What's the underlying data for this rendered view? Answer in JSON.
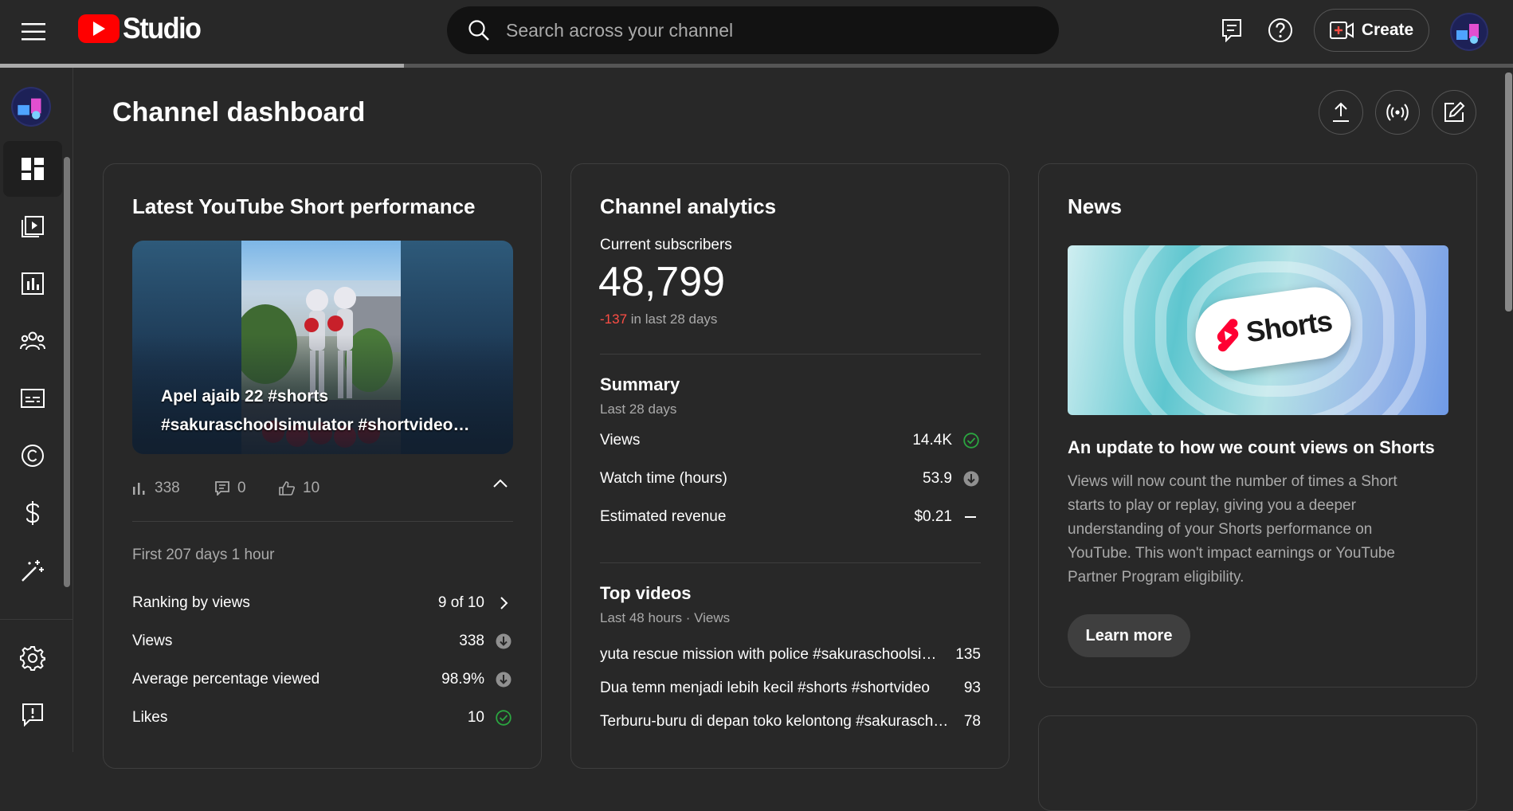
{
  "header": {
    "brand": "Studio",
    "search_placeholder": "Search across your channel",
    "create_label": "Create",
    "upload_progress": 0.267
  },
  "sidebar": {
    "items": [
      {
        "name": "dashboard",
        "icon": "dashboard-icon",
        "active": true
      },
      {
        "name": "content",
        "icon": "content-icon"
      },
      {
        "name": "analytics",
        "icon": "analytics-icon"
      },
      {
        "name": "community",
        "icon": "community-icon"
      },
      {
        "name": "subtitles",
        "icon": "subtitles-icon"
      },
      {
        "name": "copyright",
        "icon": "copyright-icon"
      },
      {
        "name": "earn",
        "icon": "dollar-icon"
      },
      {
        "name": "customization",
        "icon": "magic-wand-icon"
      }
    ],
    "bottom": [
      {
        "name": "settings",
        "icon": "gear-icon"
      },
      {
        "name": "feedback",
        "icon": "feedback-icon"
      }
    ]
  },
  "page": {
    "title": "Channel dashboard"
  },
  "short_card": {
    "title": "Latest YouTube Short performance",
    "video_title_line1": "Apel ajaib 22 #shorts",
    "video_title_line2": "#sakuraschoolsimulator #shortvideo…",
    "views": "338",
    "comments": "0",
    "likes": "10",
    "period": "First 207 days 1 hour",
    "rows": [
      {
        "label": "Ranking by views",
        "value": "9 of 10",
        "status": "chevron"
      },
      {
        "label": "Views",
        "value": "338",
        "status": "down"
      },
      {
        "label": "Average percentage viewed",
        "value": "98.9%",
        "status": "down"
      },
      {
        "label": "Likes",
        "value": "10",
        "status": "check"
      }
    ]
  },
  "analytics_card": {
    "title": "Channel analytics",
    "subs_label": "Current subscribers",
    "subs_value": "48,799",
    "subs_change": "-137",
    "subs_change_suffix": " in last 28 days",
    "summary_title": "Summary",
    "summary_period": "Last 28 days",
    "summary_rows": [
      {
        "label": "Views",
        "value": "14.4K",
        "status": "check"
      },
      {
        "label": "Watch time (hours)",
        "value": "53.9",
        "status": "down"
      },
      {
        "label": "Estimated revenue",
        "value": "$0.21",
        "status": "dash"
      }
    ],
    "top_title": "Top videos",
    "top_period": "Last 48 hours · Views",
    "top_videos": [
      {
        "title": "yuta rescue mission with police #sakuraschoolsimulator",
        "views": "135"
      },
      {
        "title": "Dua temn menjadi lebih kecil #shorts #shortvideo",
        "views": "93"
      },
      {
        "title": "Terburu-buru di depan toko kelontong #sakuraschoolsimulator",
        "views": "78"
      }
    ]
  },
  "news_card": {
    "title": "News",
    "image_word": "Shorts",
    "headline": "An update to how we count views on Shorts",
    "body": "Views will now count the number of times a Short starts to play or replay, giving you a deeper understanding of your Shorts performance on YouTube. This won't impact earnings or YouTube Partner Program eligibility.",
    "button": "Learn more"
  },
  "colors": {
    "background": "#282828",
    "accent_red": "#ff0000",
    "negative": "#ff4e45",
    "positive": "#2ba640"
  }
}
